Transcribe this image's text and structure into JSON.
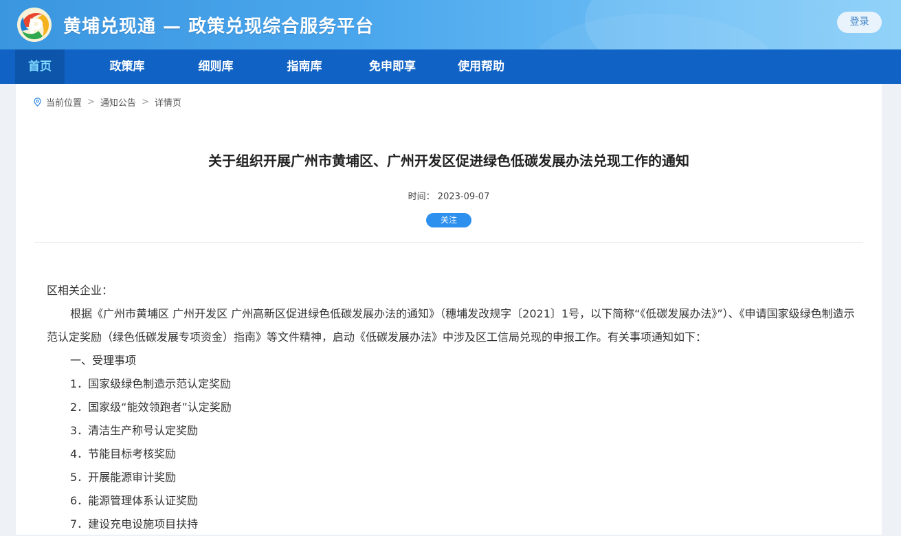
{
  "header": {
    "site_title": "黄埔兑现通 — 政策兑现综合服务平台",
    "login_label": "登录"
  },
  "nav": {
    "items": [
      {
        "label": "首页",
        "active": true
      },
      {
        "label": "政策库"
      },
      {
        "label": "细则库"
      },
      {
        "label": "指南库"
      },
      {
        "label": "免申即享"
      },
      {
        "label": "使用帮助"
      }
    ]
  },
  "breadcrumb": {
    "items": [
      "当前位置",
      "通知公告",
      "详情页"
    ],
    "separator": ">"
  },
  "article": {
    "title": "关于组织开展广州市黄埔区、广州开发区促进绿色低碳发展办法兑现工作的通知",
    "date_label": "时间：",
    "date": "2023-09-07",
    "follow_label": "关注",
    "salutation": "区相关企业：",
    "paragraph1": "根据《广州市黄埔区 广州开发区 广州高新区促进绿色低碳发展办法的通知》（穗埔发改规字〔2021〕1号，以下简称“《低碳发展办法》”）、《申请国家级绿色制造示范认定奖励（绿色低碳发展专项资金）指南》等文件精神，启动《低碳发展办法》中涉及区工信局兑现的申报工作。有关事项通知如下：",
    "section1": "一、受理事项",
    "items": [
      "1．国家级绿色制造示范认定奖励",
      "2．国家级“能效领跑者”认定奖励",
      "3．清洁生产称号认定奖励",
      "4．节能目标考核奖励",
      "5．开展能源审计奖励",
      "6．能源管理体系认证奖励",
      "7．建设充电设施项目扶持"
    ]
  },
  "colors": {
    "nav_bg": "#1063c4",
    "nav_active_text": "#7fd9ff",
    "follow_btn": "#2d8fee"
  }
}
